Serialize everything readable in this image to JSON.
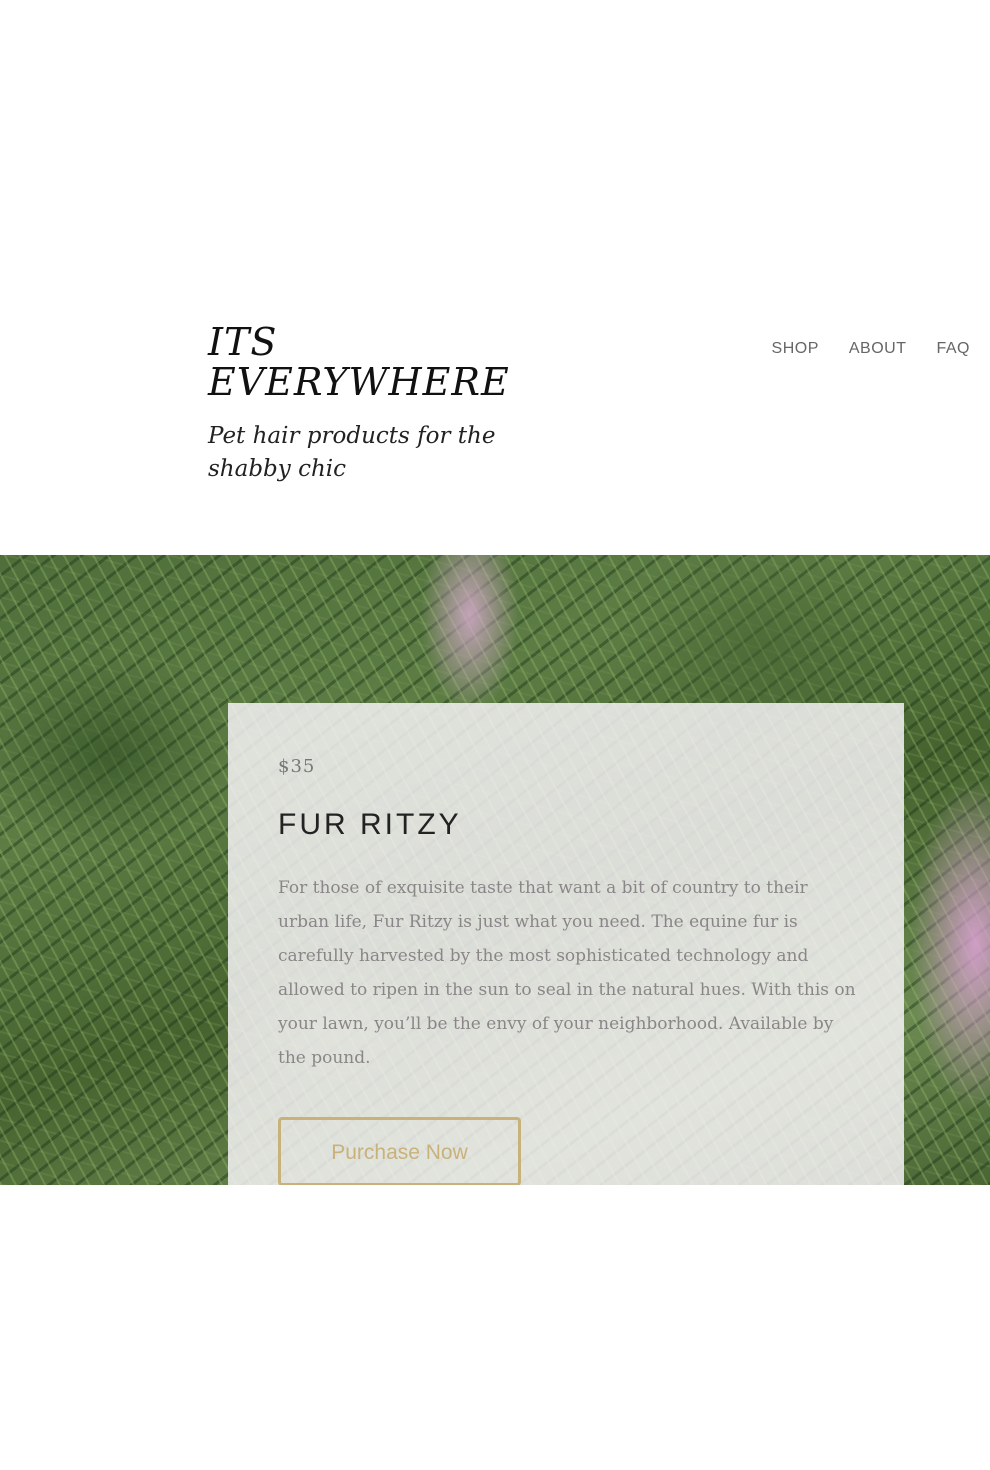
{
  "header": {
    "site_title": "ITS EVERYWHERE",
    "tagline": "Pet hair products for the shabby chic"
  },
  "nav": {
    "items": [
      {
        "label": "SHOP"
      },
      {
        "label": "ABOUT"
      },
      {
        "label": "FAQ"
      }
    ]
  },
  "product": {
    "price": "$35",
    "name": "FUR RITZY",
    "description": "For those of exquisite taste that want a bit of country to their urban life, Fur Ritzy is just what you need. The equine fur is carefully harvested by the most sophisticated technology and allowed to ripen in the sun to seal in the natural hues. With this on your lawn, you’ll be the envy of your neighborhood. Available by the pound.",
    "button_label": "Purchase Now"
  },
  "colors": {
    "accent_gold": "#c9b27a",
    "nav_text": "#666666",
    "card_background": "#f8f4f8",
    "body_text": "#8a8688"
  }
}
